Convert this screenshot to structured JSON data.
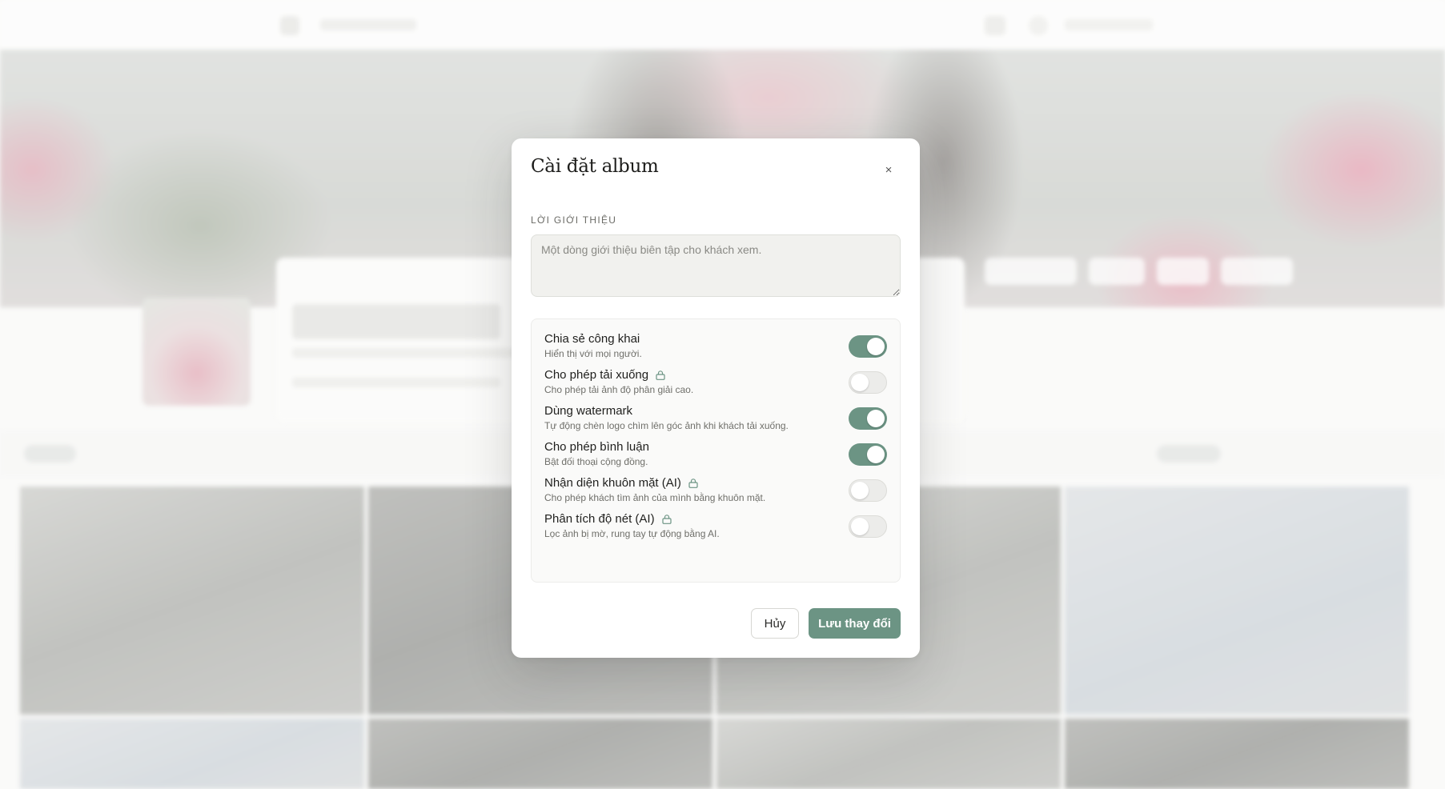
{
  "modal": {
    "title": "Cài đặt album",
    "close_label": "×",
    "intro_label": "LỜI GIỚI THIỆU",
    "intro_placeholder": "Một dòng giới thiệu biên tập cho khách xem.",
    "intro_value": "",
    "settings": [
      {
        "title": "Chia sẻ công khai",
        "desc": "Hiển thị với mọi người.",
        "locked": false,
        "enabled": true
      },
      {
        "title": "Cho phép tải xuống",
        "desc": "Cho phép tải ảnh độ phân giải cao.",
        "locked": true,
        "enabled": false
      },
      {
        "title": "Dùng watermark",
        "desc": "Tự động chèn logo chìm lên góc ảnh khi khách tải xuống.",
        "locked": false,
        "enabled": true
      },
      {
        "title": "Cho phép bình luận",
        "desc": "Bật đối thoại cộng đồng.",
        "locked": false,
        "enabled": true
      },
      {
        "title": "Nhận diện khuôn mặt (AI)",
        "desc": "Cho phép khách tìm ảnh của mình bằng khuôn mặt.",
        "locked": true,
        "enabled": false
      },
      {
        "title": "Phân tích độ nét (AI)",
        "desc": "Lọc ảnh bị mờ, rung tay tự động bằng AI.",
        "locked": true,
        "enabled": false
      }
    ],
    "cancel_label": "Hủy",
    "save_label": "Lưu thay đổi"
  },
  "colors": {
    "accent": "#6c9484",
    "toggle_off": "#ececea",
    "overlay": "rgba(255,255,255,0.45)"
  },
  "icons": {
    "locked_feature": "lock-icon",
    "close": "close-icon"
  }
}
